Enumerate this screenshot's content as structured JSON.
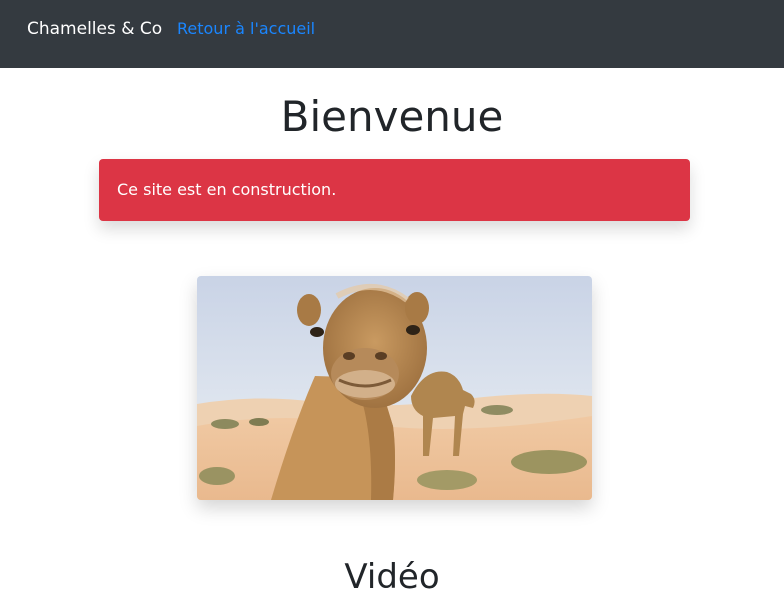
{
  "navbar": {
    "brand": "Chamelles & Co",
    "home_link": "Retour à l'accueil"
  },
  "page": {
    "title": "Bienvenue"
  },
  "alert": {
    "message": "Ce site est en construction.",
    "color": "#dc3545"
  },
  "hero_image": {
    "subject": "camel-photo"
  },
  "section": {
    "title": "Vidéo"
  },
  "colors": {
    "navbar_bg": "#343a40",
    "link": "#1a86ff",
    "alert": "#dc3545"
  }
}
